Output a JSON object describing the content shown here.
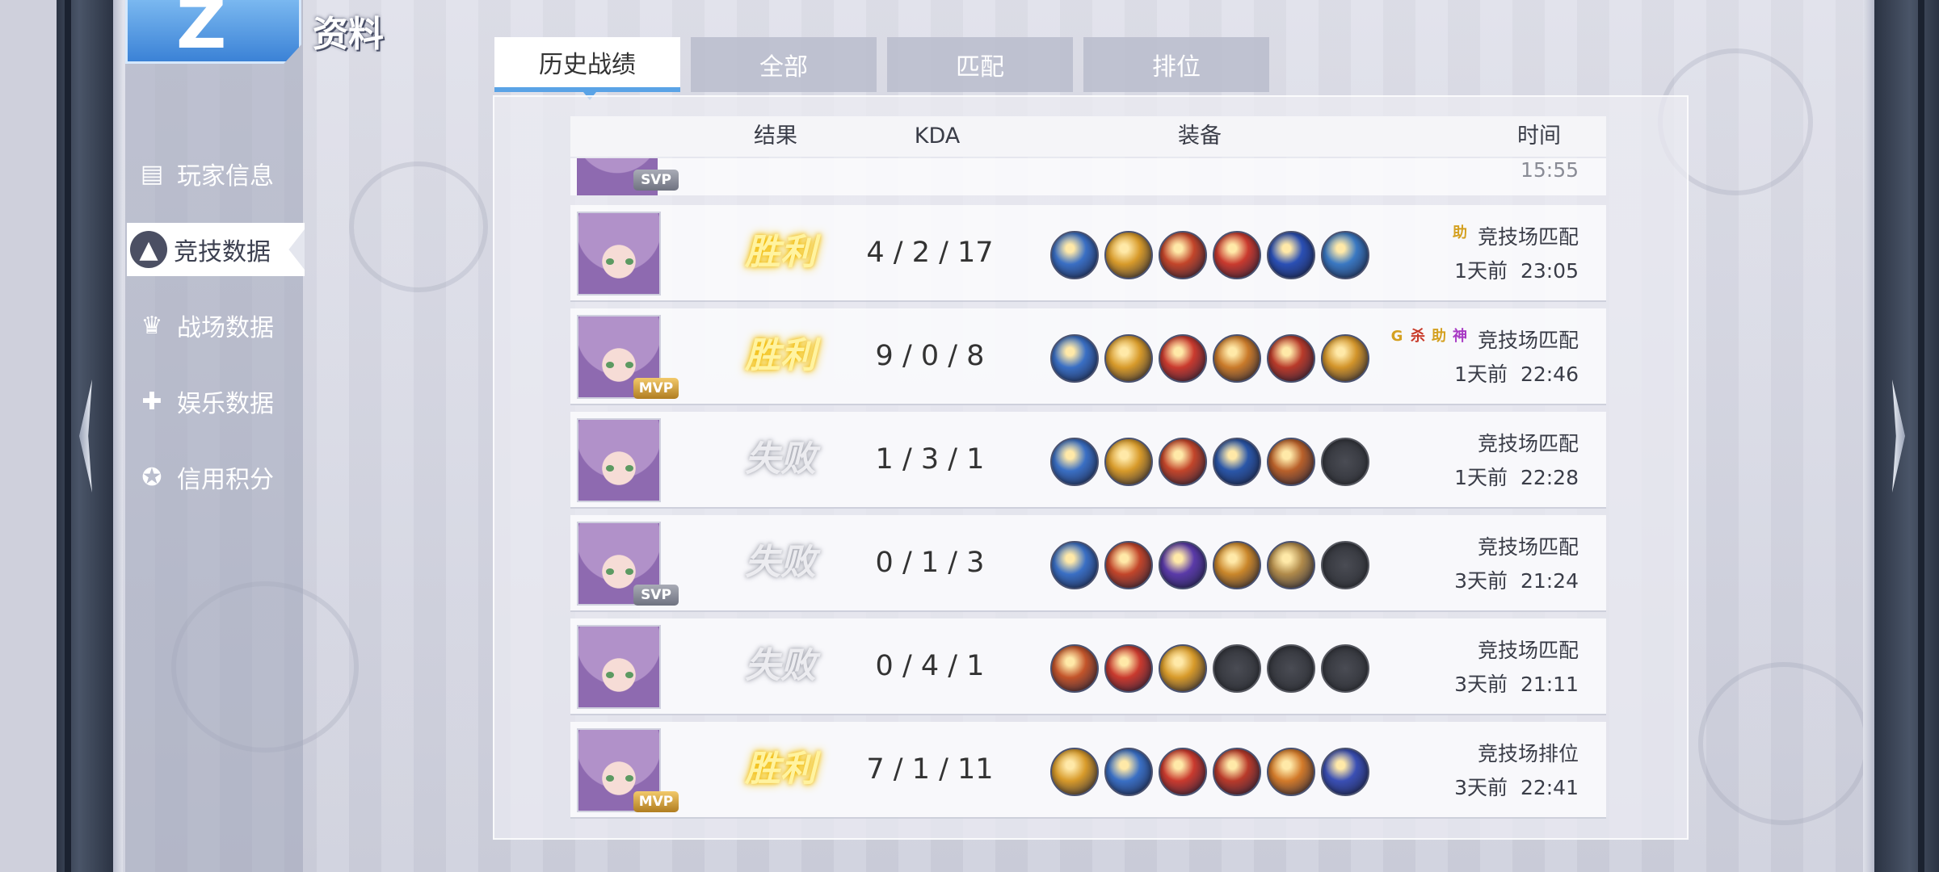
{
  "app": {
    "title": "资料",
    "logo_char": "Z"
  },
  "sidebar": {
    "items": [
      {
        "label": "玩家信息",
        "icon": "player-card-icon"
      },
      {
        "label": "竞技数据",
        "icon": "triforce-icon",
        "active": true
      },
      {
        "label": "战场数据",
        "icon": "crown-icon"
      },
      {
        "label": "娱乐数据",
        "icon": "gamepad-icon"
      },
      {
        "label": "信用积分",
        "icon": "medal-icon"
      }
    ]
  },
  "tabs": [
    {
      "label": "历史战绩",
      "active": true
    },
    {
      "label": "全部"
    },
    {
      "label": "匹配"
    },
    {
      "label": "排位"
    }
  ],
  "table": {
    "headers": {
      "result": "结果",
      "kda": "KDA",
      "equipment": "装备",
      "time": "时间"
    },
    "partial_row": {
      "badge": "SVP",
      "time_fragment": "15:55"
    },
    "rows": [
      {
        "badge": "",
        "result": "胜利",
        "outcome": "win",
        "kda": "4 / 2 / 17",
        "flags": [
          "助"
        ],
        "mode": "竞技场匹配",
        "time": "1天前  23:05",
        "items": [
          "#3a6fc4",
          "#d79a2a",
          "#c2452a",
          "#c93a2e",
          "#2a4fb4",
          "#3a78c2"
        ]
      },
      {
        "badge": "MVP",
        "result": "胜利",
        "outcome": "win",
        "kda": "9 / 0 / 8",
        "flags": [
          "G",
          "杀",
          "助",
          "神"
        ],
        "mode": "竞技场匹配",
        "time": "1天前  22:46",
        "items": [
          "#3a6fc4",
          "#d79a2a",
          "#c93a2e",
          "#c97a2a",
          "#b83a2a",
          "#d2942a"
        ]
      },
      {
        "badge": "",
        "result": "失败",
        "outcome": "lose",
        "kda": "1 / 3 / 1",
        "flags": [],
        "mode": "竞技场匹配",
        "time": "1天前  22:28",
        "items": [
          "#3a6fc4",
          "#d79a2a",
          "#c2452a",
          "#2a56a8",
          "#b8602a",
          "empty"
        ]
      },
      {
        "badge": "SVP",
        "result": "失败",
        "outcome": "lose",
        "kda": "0 / 1 / 3",
        "flags": [],
        "mode": "竞技场匹配",
        "time": "3天前  21:24",
        "items": [
          "#3a6fc4",
          "#c2452a",
          "#5a3aa8",
          "#c9862a",
          "#b08a4a",
          "empty"
        ]
      },
      {
        "badge": "",
        "result": "失败",
        "outcome": "lose",
        "kda": "0 / 4 / 1",
        "flags": [],
        "mode": "竞技场匹配",
        "time": "3天前  21:11",
        "items": [
          "#c2542a",
          "#c93a2e",
          "#d79a2a",
          "empty",
          "empty",
          "empty"
        ]
      },
      {
        "badge": "MVP",
        "result": "胜利",
        "outcome": "win",
        "kda": "7 / 1 / 11",
        "flags": [],
        "mode": "竞技场排位",
        "time": "3天前  22:41",
        "items": [
          "#d79a2a",
          "#3a6fc4",
          "#c93a2e",
          "#b83a2a",
          "#d27a2a",
          "#3a4fb4"
        ]
      }
    ]
  },
  "colors": {
    "accent": "#5aa3e6",
    "win_glow": "#f6c800",
    "flag_colors": {
      "G": "#d4a020",
      "杀": "#c83a2a",
      "助": "#d4a020",
      "神": "#a83ac4"
    }
  }
}
